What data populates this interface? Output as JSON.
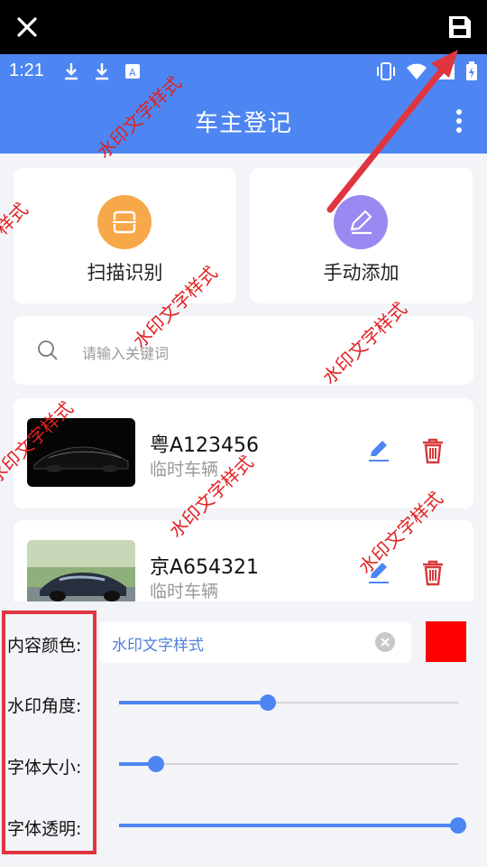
{
  "status": {
    "time": "1:21"
  },
  "appbar": {
    "title": "车主登记"
  },
  "actions": [
    {
      "label": "扫描识别",
      "icon": "scan-icon",
      "color": "#f7a94a"
    },
    {
      "label": "手动添加",
      "icon": "pencil-icon",
      "color": "#9b88f1"
    }
  ],
  "search": {
    "placeholder": "请输入关键词"
  },
  "vehicles": [
    {
      "plate": "粤A123456",
      "type": "临时车辆"
    },
    {
      "plate": "京A654321",
      "type": "临时车辆"
    }
  ],
  "panel": {
    "color_label": "内容颜色:",
    "color_value": "水印文字样式",
    "swatch_color": "#ff0000",
    "angle_label": "水印角度:",
    "angle_value": 0.44,
    "size_label": "字体大小:",
    "size_value": 0.11,
    "alpha_label": "字体透明:",
    "alpha_value": 1.0
  },
  "watermark": {
    "text": "水印文字样式"
  },
  "colors": {
    "primary": "#4d86f2",
    "highlight": "#e0353f"
  }
}
